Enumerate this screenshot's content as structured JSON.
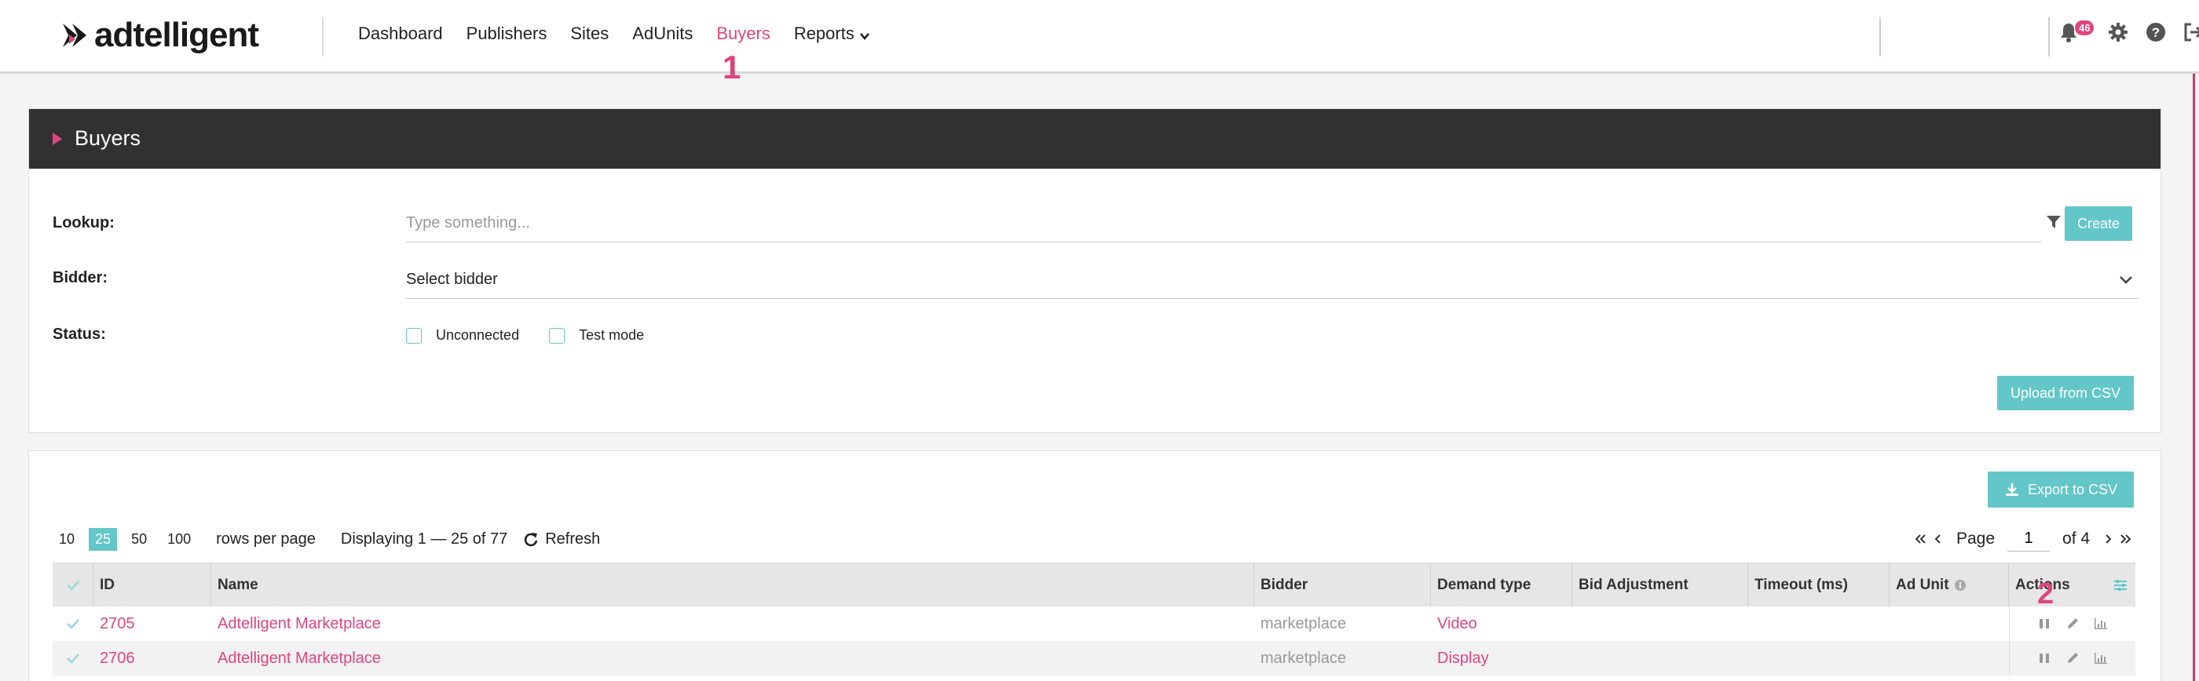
{
  "app": {
    "logo_text": "adtelligent",
    "accent_color": "#e0447f",
    "teal_color": "#63c6c8"
  },
  "nav": {
    "items": [
      {
        "label": "Dashboard",
        "active": false
      },
      {
        "label": "Publishers",
        "active": false
      },
      {
        "label": "Sites",
        "active": false
      },
      {
        "label": "AdUnits",
        "active": false
      },
      {
        "label": "Buyers",
        "active": true
      },
      {
        "label": "Reports",
        "active": false,
        "has_dropdown": true
      }
    ],
    "step_marker": "1",
    "notification_count": "46",
    "icons": [
      "bell-icon",
      "gear-icon",
      "help-icon",
      "logout-icon"
    ]
  },
  "filters": {
    "header_title": "Buyers",
    "lookup_label": "Lookup:",
    "lookup_placeholder": "Type something...",
    "lookup_value": "",
    "create_label": "Create",
    "bidder_label": "Bidder:",
    "bidder_value": "Select bidder",
    "status_label": "Status:",
    "status_options": [
      {
        "label": "Unconnected",
        "checked": false
      },
      {
        "label": "Test mode",
        "checked": false
      }
    ],
    "upload_label": "Upload from CSV"
  },
  "table_controls": {
    "export_label": "Export to CSV",
    "page_sizes": [
      "10",
      "25",
      "50",
      "100"
    ],
    "active_page_size": "25",
    "rows_per_page_label": "rows per page",
    "displaying_text": "Displaying 1 — 25 of 77",
    "refresh_label": "Refresh",
    "page_label": "Page",
    "current_page": "1",
    "of_pages_label": "of 4"
  },
  "table": {
    "columns": [
      "ID",
      "Name",
      "Bidder",
      "Demand type",
      "Bid Adjustment",
      "Timeout (ms)",
      "Ad Unit",
      "Actions"
    ],
    "rows": [
      {
        "id": "2705",
        "name": "Adtelligent Marketplace",
        "bidder": "marketplace",
        "demand_type": "Video",
        "bid_adjustment": "",
        "timeout": "",
        "ad_unit": ""
      },
      {
        "id": "2706",
        "name": "Adtelligent Marketplace",
        "bidder": "marketplace",
        "demand_type": "Display",
        "bid_adjustment": "",
        "timeout": "",
        "ad_unit": ""
      }
    ],
    "actions_step_marker": "2"
  }
}
